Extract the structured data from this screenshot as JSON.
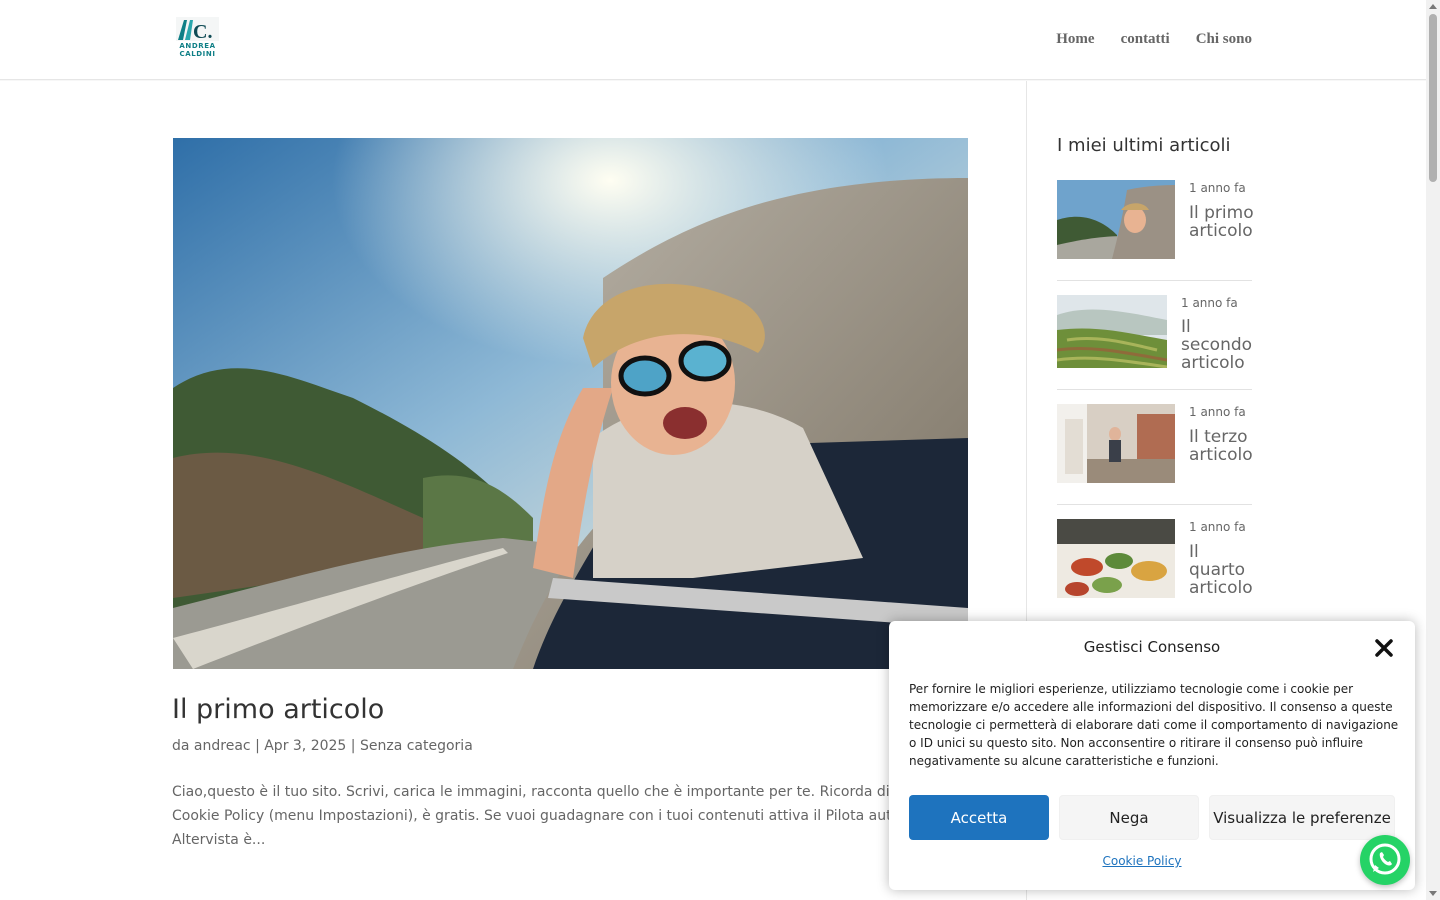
{
  "logo": {
    "letters": "AC.",
    "line1": "ANDREA",
    "line2": "CALDINI"
  },
  "nav": {
    "items": [
      "Home",
      "contatti",
      "Chi sono"
    ]
  },
  "post": {
    "title": "Il primo articolo",
    "meta_prefix": "da",
    "author": "andreac",
    "date": "Apr 3, 2025",
    "category": "Senza categoria",
    "excerpt": "Ciao,questo è il tuo sito. Scrivi, carica le immagini, racconta quello che è importante per te. Ricorda di attivare la Cookie Policy (menu Impostazioni), è gratis. Se vuoi guadagnare con i tuoi contenuti attiva il Pilota automatico di Altervista è..."
  },
  "sidebar": {
    "title": "I miei ultimi articoli",
    "articles": [
      {
        "ago": "1 anno fa",
        "title": "Il primo articolo"
      },
      {
        "ago": "1 anno fa",
        "title": "Il secondo articolo"
      },
      {
        "ago": "1 anno fa",
        "title": "Il terzo articolo"
      },
      {
        "ago": "1 anno fa",
        "title": "Il quarto articolo"
      }
    ]
  },
  "cookie": {
    "title": "Gestisci Consenso",
    "text": "Per fornire le migliori esperienze, utilizziamo tecnologie come i cookie per memorizzare e/o accedere alle informazioni del dispositivo. Il consenso a queste tecnologie ci permetterà di elaborare dati come il comportamento di navigazione o ID unici su questo sito. Non acconsentire o ritirare il consenso può influire negativamente su alcune caratteristiche e funzioni.",
    "accept": "Accetta",
    "deny": "Nega",
    "preferences": "Visualizza le preferenze",
    "policy": "Cookie Policy"
  },
  "colors": {
    "accent": "#1e73be",
    "whatsapp": "#25d366",
    "logo_teal": "#0f7f86"
  },
  "icons": {
    "close": "close-icon",
    "whatsapp": "whatsapp-icon"
  }
}
